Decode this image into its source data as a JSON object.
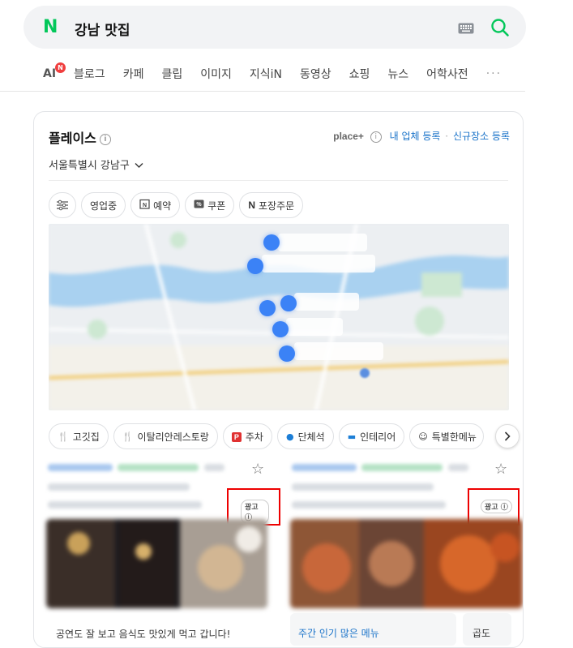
{
  "search": {
    "logo": "N",
    "query": "강남 맛집"
  },
  "tabs": {
    "ai": "AI",
    "ai_badge": "N",
    "items": [
      "블로그",
      "카페",
      "클립",
      "이미지",
      "지식iN",
      "동영상",
      "쇼핑",
      "뉴스",
      "어학사전"
    ],
    "more": "···"
  },
  "place": {
    "title": "플레이스",
    "info": "i",
    "place_plus": "place+",
    "register_business": "내 업체 등록",
    "sep": "·",
    "register_new": "신규장소 등록",
    "region": "서울특별시 강남구",
    "filters": [
      "영업중",
      "예약",
      "쿠폰",
      "포장주문"
    ],
    "categories": [
      "고깃집",
      "이탈리안레스토랑",
      "주차",
      "단체석",
      "인테리어",
      "특별한메뉴"
    ]
  },
  "listings": [
    {
      "ad": "광고",
      "review": "공연도 잘 보고 음식도 맛있게 먹고 갑니다!"
    },
    {
      "ad": "광고",
      "review": "주간 인기 많은 메뉴",
      "review2": "곱도"
    }
  ],
  "colors": {
    "brand": "#03c75a",
    "link": "#1a73c9",
    "pin": "#3b82f6",
    "highlight": "#e00000"
  }
}
